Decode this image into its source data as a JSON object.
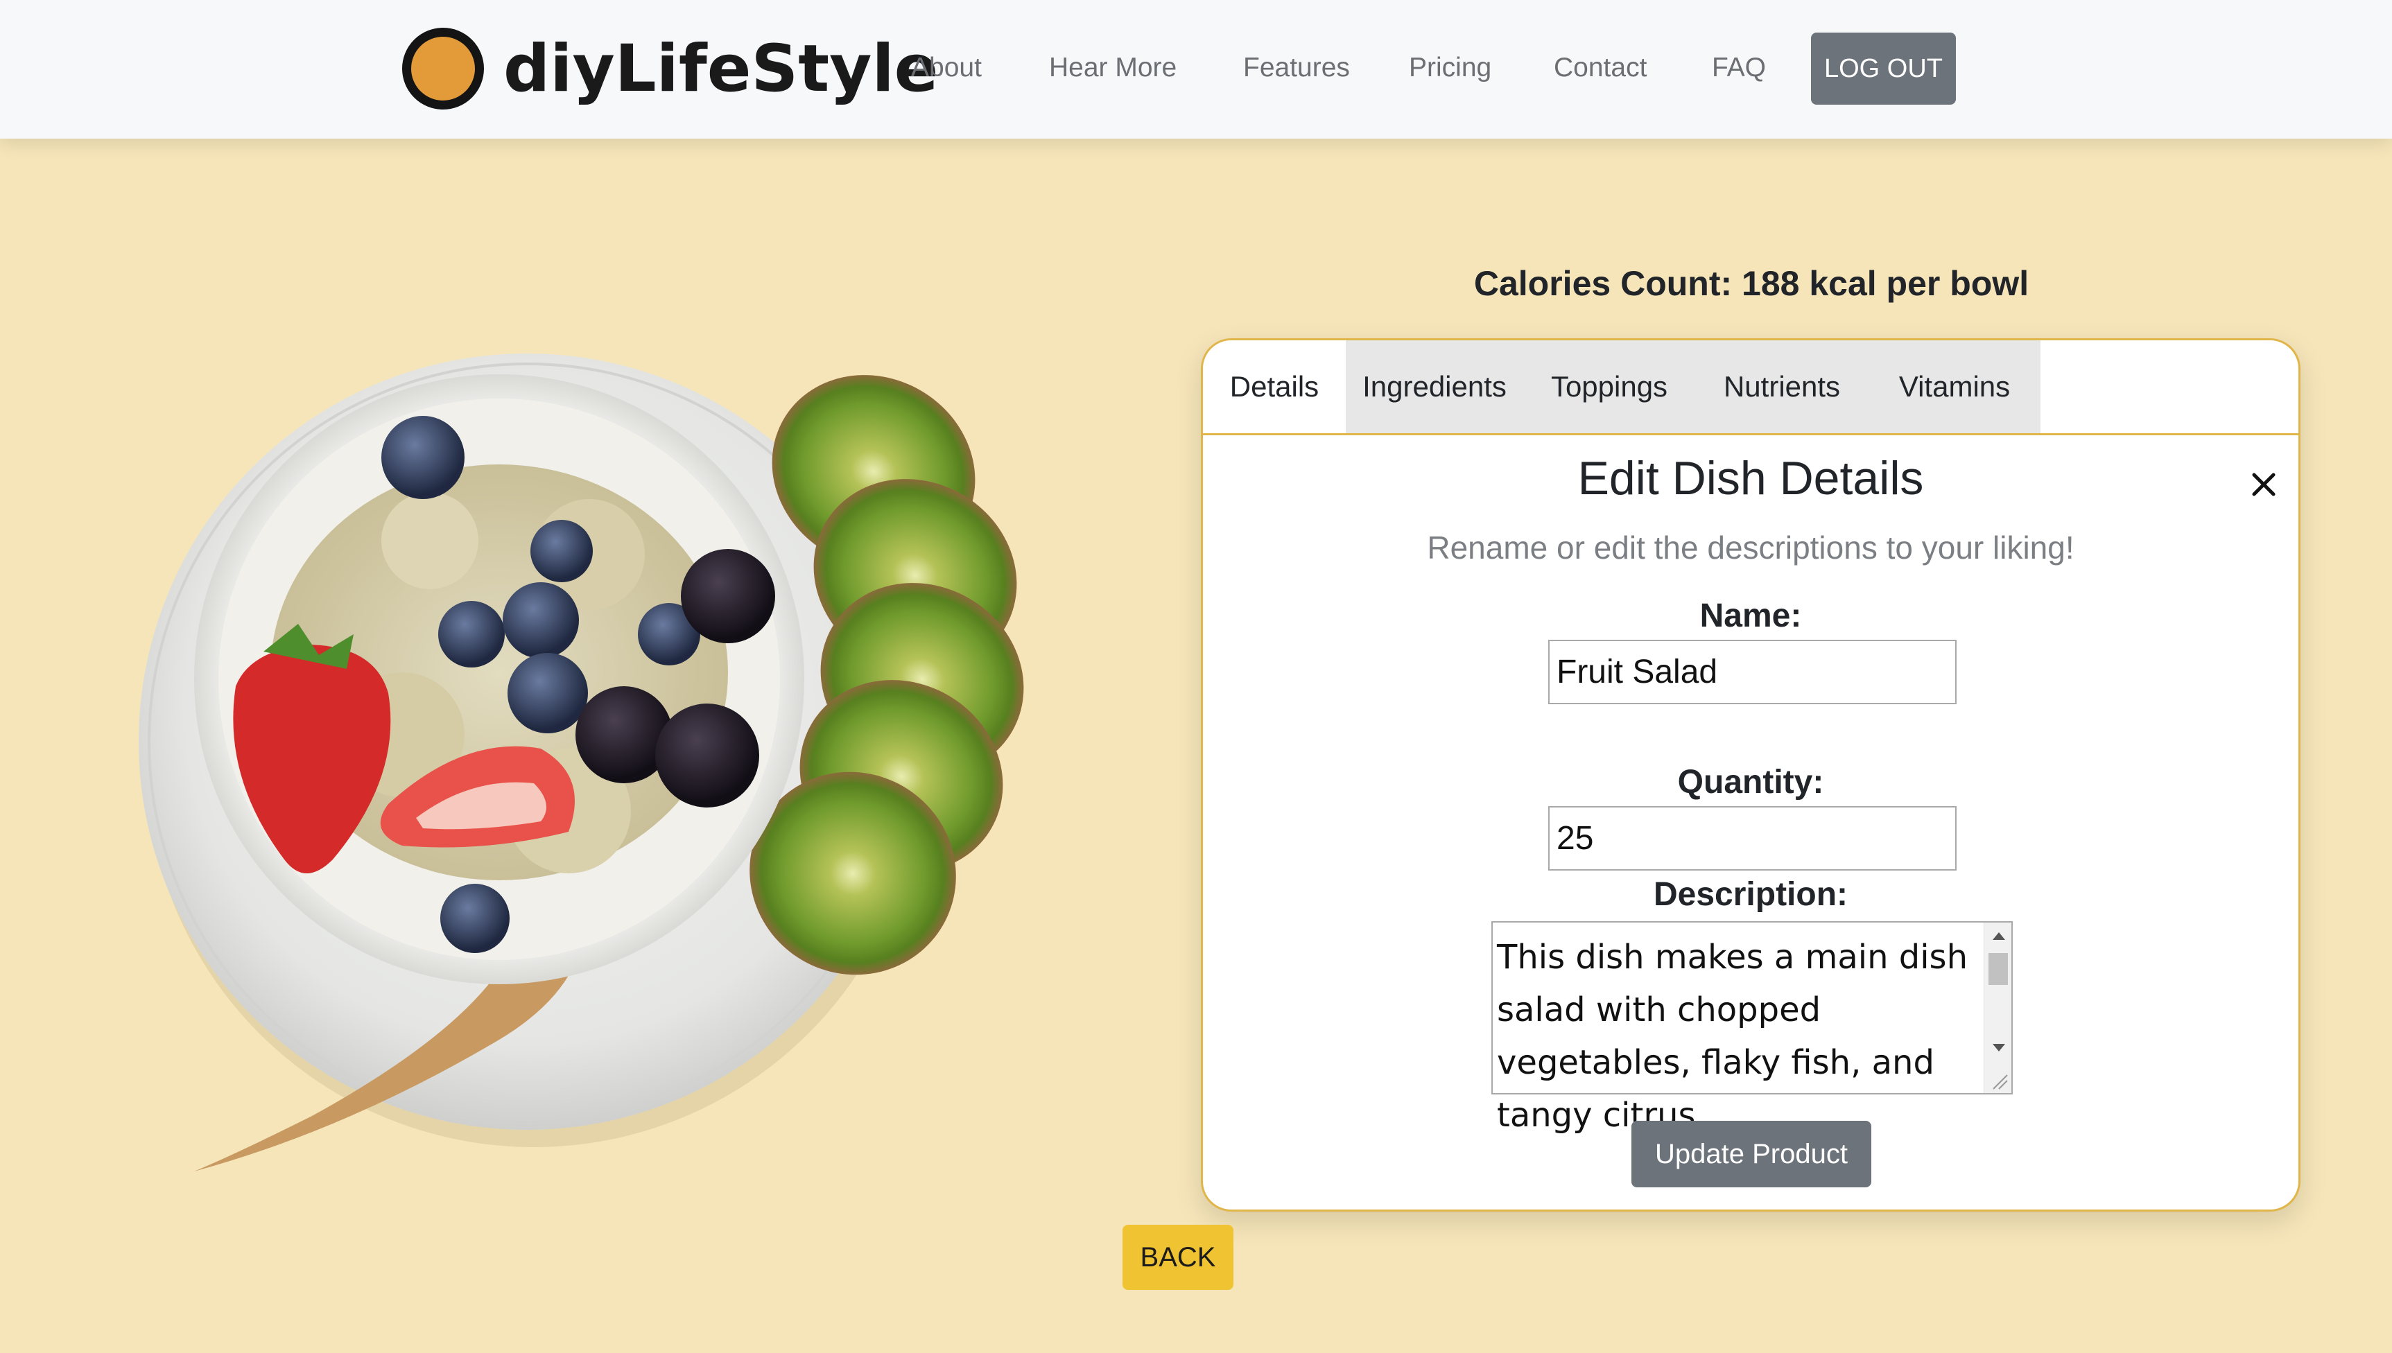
{
  "colors": {
    "page_background": "#f6e5b9",
    "navbar_background": "#f7f8fa",
    "logo_orange": "#e39a39",
    "card_border": "#e0b54a",
    "button_gray": "#6c737b",
    "back_button_yellow": "#f0c332"
  },
  "navbar": {
    "brand": "diyLifeStyle",
    "logo_icon": "orange-circle-logo-icon",
    "links": [
      "About",
      "Hear More",
      "Features",
      "Pricing",
      "Contact",
      "FAQ"
    ],
    "logout_label": "LOG OUT"
  },
  "calories": {
    "text": "Calories Count: 188 kcal per bowl"
  },
  "tabs": [
    "Details",
    "Ingredients",
    "Toppings",
    "Nutrients",
    "Vitamins"
  ],
  "active_tab": "Details",
  "form": {
    "title": "Edit Dish Details",
    "subtitle": "Rename or edit the descriptions to your liking!",
    "close_icon": "close-icon",
    "name_label": "Name:",
    "name_value": "Fruit Salad",
    "quantity_label": "Quantity:",
    "quantity_value": "25",
    "description_label": "Description:",
    "description_value": "This dish makes a main dish salad with chopped vegetables, flaky fish, and tangy citrus",
    "update_label": "Update Product"
  },
  "back_label": "BACK"
}
